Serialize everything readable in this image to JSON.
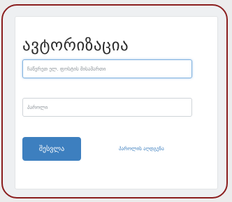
{
  "login": {
    "title": "ავტორიზაცია",
    "email_placeholder": "ჩაწერეთ ელ. ფოსტის მისამართი",
    "password_placeholder": "პაროლი",
    "login_button": "შესვლა",
    "forgot_link": "პაროლის აღდგენა"
  },
  "colors": {
    "frame_border": "#8b1e1e",
    "primary": "#3d7fbf",
    "focus_ring": "#7fb1df"
  }
}
